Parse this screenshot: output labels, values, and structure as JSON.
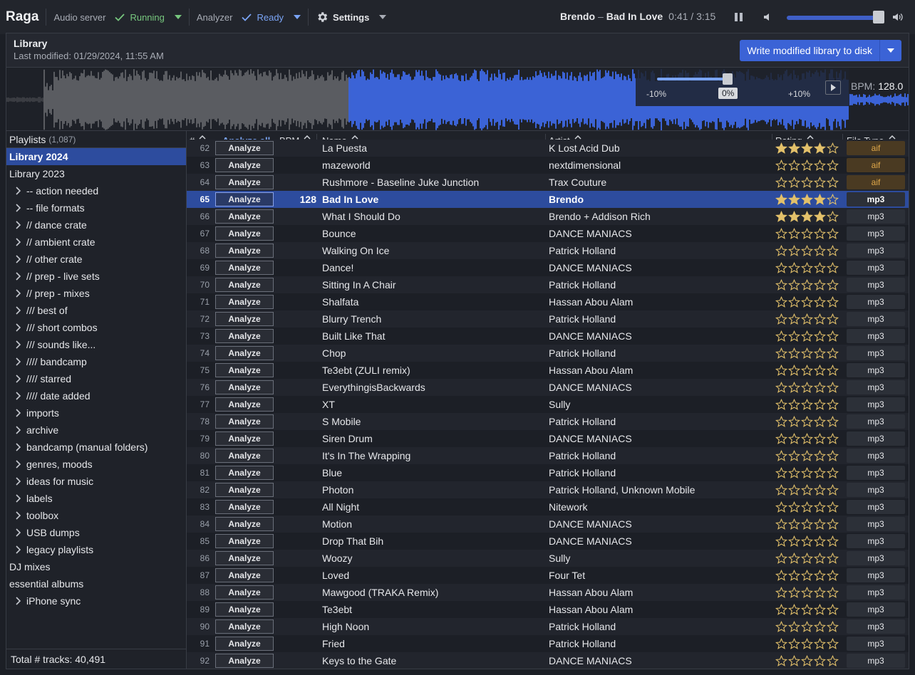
{
  "app": {
    "name": "Raga",
    "audio_server_label": "Audio server",
    "audio_server_status": "Running",
    "analyzer_label": "Analyzer",
    "analyzer_status": "Ready",
    "settings_label": "Settings"
  },
  "now_playing": {
    "artist": "Brendo",
    "separator": "–",
    "title": "Bad In Love",
    "time": "0:41 / 3:15",
    "volume": 0.95
  },
  "library": {
    "title": "Library",
    "last_modified": "Last modified: 01/29/2024, 11:55 AM",
    "write_label": "Write modified library to disk"
  },
  "waveform": {
    "progress": 0.21,
    "tempo_min": "-10%",
    "tempo_value": "0%",
    "tempo_max": "+10%",
    "bpm_label": "BPM:",
    "bpm_value": "128.0"
  },
  "sidebar": {
    "header": "Playlists",
    "count": "(1,087)",
    "footer": "Total # tracks: 40,491",
    "items": [
      {
        "label": "Library 2024",
        "folder": false,
        "selected": true
      },
      {
        "label": "Library 2023",
        "folder": false,
        "selected": false
      },
      {
        "label": "-- action needed",
        "folder": true
      },
      {
        "label": "-- file formats",
        "folder": true
      },
      {
        "label": "// dance crate",
        "folder": true
      },
      {
        "label": "// ambient crate",
        "folder": true
      },
      {
        "label": "// other crate",
        "folder": true
      },
      {
        "label": "// prep - live sets",
        "folder": true
      },
      {
        "label": "// prep - mixes",
        "folder": true
      },
      {
        "label": "/// best of",
        "folder": true
      },
      {
        "label": "/// short combos",
        "folder": true
      },
      {
        "label": "/// sounds like...",
        "folder": true
      },
      {
        "label": "//// bandcamp",
        "folder": true
      },
      {
        "label": "//// starred",
        "folder": true
      },
      {
        "label": "//// date added",
        "folder": true
      },
      {
        "label": "imports",
        "folder": true
      },
      {
        "label": "archive",
        "folder": true
      },
      {
        "label": "bandcamp (manual folders)",
        "folder": true
      },
      {
        "label": "genres, moods",
        "folder": true
      },
      {
        "label": "ideas for music",
        "folder": true
      },
      {
        "label": "labels",
        "folder": true
      },
      {
        "label": "toolbox",
        "folder": true
      },
      {
        "label": "USB dumps",
        "folder": true
      },
      {
        "label": "legacy playlists",
        "folder": true
      },
      {
        "label": "DJ mixes",
        "folder": false
      },
      {
        "label": "essential albums",
        "folder": false
      },
      {
        "label": "iPhone sync",
        "folder": true
      }
    ]
  },
  "table": {
    "columns": {
      "num": "#",
      "analyze_all": "Analyze all",
      "bpm": "BPM",
      "name": "Name",
      "artist": "Artist",
      "rating": "Rating",
      "file_type": "File Type"
    },
    "analyze_label": "Analyze",
    "rows": [
      {
        "num": "62",
        "bpm": "",
        "name": "La Puesta",
        "artist": "K Lost Acid Dub",
        "rating": 4,
        "ft": "aif"
      },
      {
        "num": "63",
        "bpm": "",
        "name": "mazeworld",
        "artist": "nextdimensional",
        "rating": 0,
        "ft": "aif"
      },
      {
        "num": "64",
        "bpm": "",
        "name": "Rushmore - Baseline Juke Junction",
        "artist": "Trax Couture",
        "rating": 0,
        "ft": "aif"
      },
      {
        "num": "65",
        "bpm": "128",
        "name": "Bad In Love",
        "artist": "Brendo",
        "rating": 4,
        "ft": "mp3",
        "selected": true
      },
      {
        "num": "66",
        "bpm": "",
        "name": "What I Should Do",
        "artist": "Brendo + Addison Rich",
        "rating": 4,
        "ft": "mp3"
      },
      {
        "num": "67",
        "bpm": "",
        "name": "Bounce",
        "artist": "DANCE MANIACS",
        "rating": 0,
        "ft": "mp3"
      },
      {
        "num": "68",
        "bpm": "",
        "name": "Walking On Ice",
        "artist": "Patrick Holland",
        "rating": 0,
        "ft": "mp3"
      },
      {
        "num": "69",
        "bpm": "",
        "name": "Dance!",
        "artist": "DANCE MANIACS",
        "rating": 0,
        "ft": "mp3"
      },
      {
        "num": "70",
        "bpm": "",
        "name": "Sitting In A Chair",
        "artist": "Patrick Holland",
        "rating": 0,
        "ft": "mp3"
      },
      {
        "num": "71",
        "bpm": "",
        "name": "Shalfata",
        "artist": "Hassan Abou Alam",
        "rating": 0,
        "ft": "mp3"
      },
      {
        "num": "72",
        "bpm": "",
        "name": "Blurry Trench",
        "artist": "Patrick Holland",
        "rating": 0,
        "ft": "mp3"
      },
      {
        "num": "73",
        "bpm": "",
        "name": "Built Like That",
        "artist": "DANCE MANIACS",
        "rating": 0,
        "ft": "mp3"
      },
      {
        "num": "74",
        "bpm": "",
        "name": "Chop",
        "artist": "Patrick Holland",
        "rating": 0,
        "ft": "mp3"
      },
      {
        "num": "75",
        "bpm": "",
        "name": "Te3ebt (ZULI remix)",
        "artist": "Hassan Abou Alam",
        "rating": 0,
        "ft": "mp3"
      },
      {
        "num": "76",
        "bpm": "",
        "name": "EverythingisBackwards",
        "artist": "DANCE MANIACS",
        "rating": 0,
        "ft": "mp3"
      },
      {
        "num": "77",
        "bpm": "",
        "name": "XT",
        "artist": "Sully",
        "rating": 0,
        "ft": "mp3"
      },
      {
        "num": "78",
        "bpm": "",
        "name": "S Mobile",
        "artist": "Patrick Holland",
        "rating": 0,
        "ft": "mp3"
      },
      {
        "num": "79",
        "bpm": "",
        "name": "Siren Drum",
        "artist": "DANCE MANIACS",
        "rating": 0,
        "ft": "mp3"
      },
      {
        "num": "80",
        "bpm": "",
        "name": "It's In The Wrapping",
        "artist": "Patrick Holland",
        "rating": 0,
        "ft": "mp3"
      },
      {
        "num": "81",
        "bpm": "",
        "name": "Blue",
        "artist": "Patrick Holland",
        "rating": 0,
        "ft": "mp3"
      },
      {
        "num": "82",
        "bpm": "",
        "name": "Photon",
        "artist": "Patrick Holland, Unknown Mobile",
        "rating": 0,
        "ft": "mp3"
      },
      {
        "num": "83",
        "bpm": "",
        "name": "All Night",
        "artist": "Nitework",
        "rating": 0,
        "ft": "mp3"
      },
      {
        "num": "84",
        "bpm": "",
        "name": "Motion",
        "artist": "DANCE MANIACS",
        "rating": 0,
        "ft": "mp3"
      },
      {
        "num": "85",
        "bpm": "",
        "name": "Drop That Bih",
        "artist": "DANCE MANIACS",
        "rating": 0,
        "ft": "mp3"
      },
      {
        "num": "86",
        "bpm": "",
        "name": "Woozy",
        "artist": "Sully",
        "rating": 0,
        "ft": "mp3"
      },
      {
        "num": "87",
        "bpm": "",
        "name": "Loved",
        "artist": "Four Tet",
        "rating": 0,
        "ft": "mp3"
      },
      {
        "num": "88",
        "bpm": "",
        "name": "Mawgood (TRAKA Remix)",
        "artist": "Hassan Abou Alam",
        "rating": 0,
        "ft": "mp3"
      },
      {
        "num": "89",
        "bpm": "",
        "name": "Te3ebt",
        "artist": "Hassan Abou Alam",
        "rating": 0,
        "ft": "mp3"
      },
      {
        "num": "90",
        "bpm": "",
        "name": "High Noon",
        "artist": "Patrick Holland",
        "rating": 0,
        "ft": "mp3"
      },
      {
        "num": "91",
        "bpm": "",
        "name": "Fried",
        "artist": "Patrick Holland",
        "rating": 0,
        "ft": "mp3"
      },
      {
        "num": "92",
        "bpm": "",
        "name": "Keys to the Gate",
        "artist": "DANCE MANIACS",
        "rating": 0,
        "ft": "mp3"
      }
    ]
  },
  "colors": {
    "accent": "#3b63d6",
    "selected_row": "#2d4c9e",
    "running": "#77c77e",
    "ready": "#7aa4f5",
    "star": "#e2c06a",
    "waveform_played": "#5a5c61",
    "waveform_unplayed": "#3b63d6"
  }
}
